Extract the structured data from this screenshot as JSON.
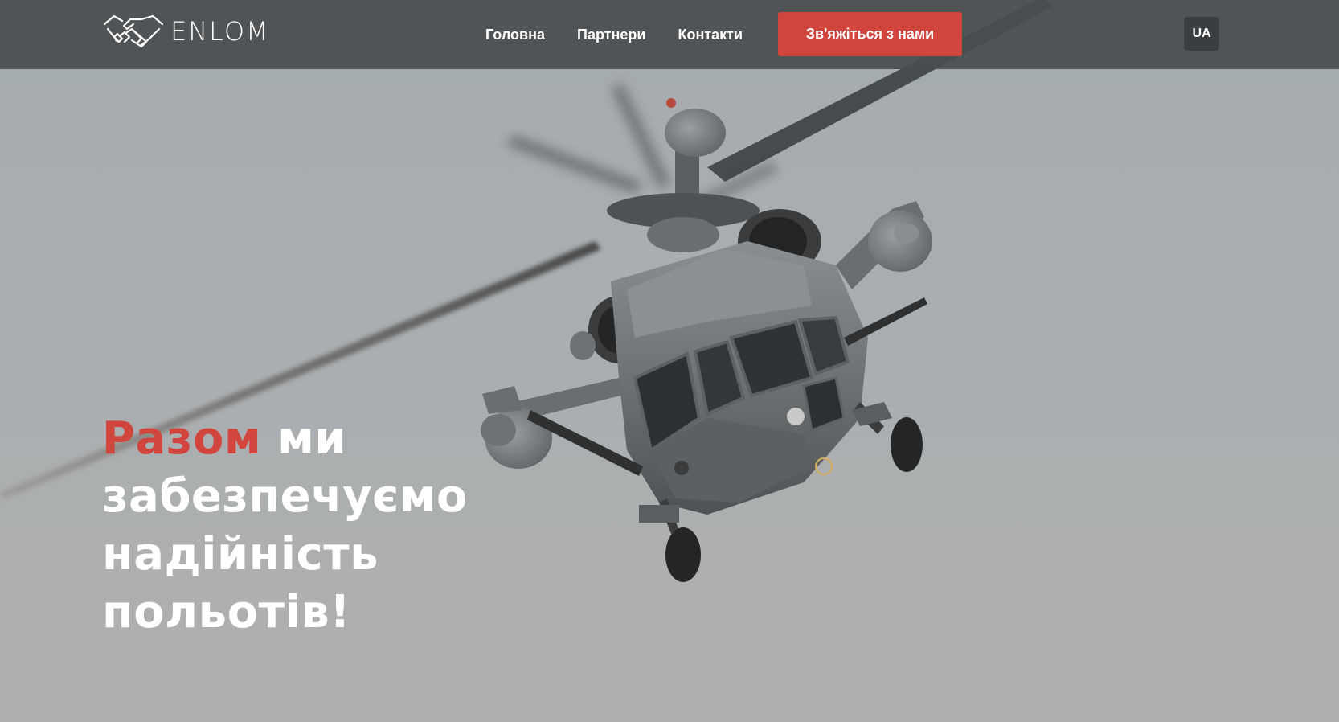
{
  "brand": {
    "name": "ENLOM",
    "logo_icon": "handshake-icon"
  },
  "nav": {
    "items": [
      {
        "label": "Головна"
      },
      {
        "label": "Партнери"
      },
      {
        "label": "Контакти"
      }
    ],
    "cta_label": "Зв'яжіться з нами",
    "language": "UA"
  },
  "hero": {
    "image": "helicopter-photo",
    "headline": {
      "accent_word": "Разом",
      "rest_first_line": " ми",
      "line2": "забезпечуємо",
      "line3": "надійність",
      "line4": "польотів!"
    }
  },
  "colors": {
    "accent": "#d0453d",
    "header_bg": "#4a4d50",
    "sky": "#a8acae",
    "lang_bg": "#3b3e41"
  }
}
